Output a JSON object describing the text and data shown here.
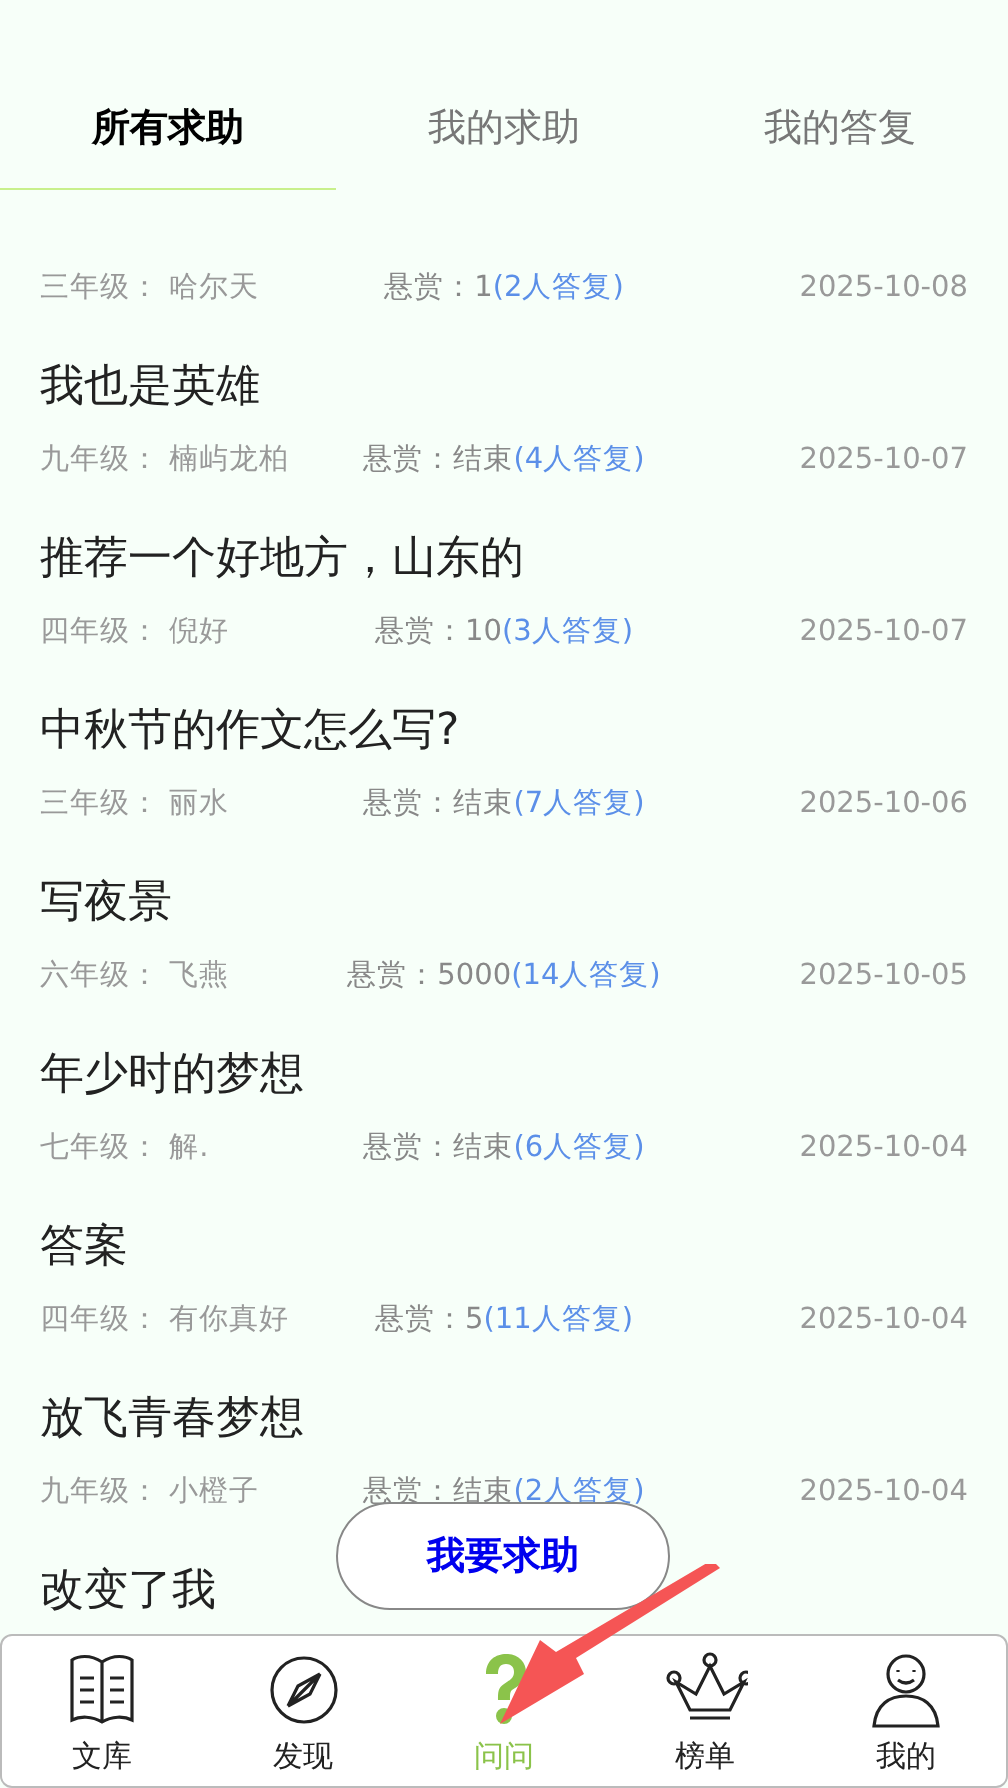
{
  "tabs": [
    {
      "label": "所有求助",
      "selected": true
    },
    {
      "label": "我的求助",
      "selected": false
    },
    {
      "label": "我的答复",
      "selected": false
    }
  ],
  "posts": [
    {
      "grade": "三年级：",
      "author": "哈尔天",
      "reward": "悬赏：1",
      "replies": "(2人答复)",
      "date": "2025-10-08"
    },
    {
      "title": "我也是英雄",
      "grade": "九年级：",
      "author": "楠屿龙柏",
      "reward": "悬赏：结束",
      "replies": "(4人答复)",
      "date": "2025-10-07"
    },
    {
      "title": "推荐一个好地方，山东的",
      "grade": "四年级：",
      "author": "倪好",
      "reward": "悬赏：10",
      "replies": "(3人答复)",
      "date": "2025-10-07"
    },
    {
      "title": "中秋节的作文怎么写?",
      "grade": "三年级：",
      "author": "丽水",
      "reward": "悬赏：结束",
      "replies": "(7人答复)",
      "date": "2025-10-06"
    },
    {
      "title": "写夜景",
      "grade": "六年级：",
      "author": "飞燕",
      "reward": "悬赏：5000",
      "replies": "(14人答复)",
      "date": "2025-10-05"
    },
    {
      "title": "年少时的梦想",
      "grade": "七年级：",
      "author": "解.",
      "reward": "悬赏：结束",
      "replies": "(6人答复)",
      "date": "2025-10-04"
    },
    {
      "title": "答案",
      "grade": "四年级：",
      "author": "有你真好",
      "reward": "悬赏：5",
      "replies": "(11人答复)",
      "date": "2025-10-04"
    },
    {
      "title": "放飞青春梦想",
      "grade": "九年级：",
      "author": "小橙子",
      "reward": "悬赏：结束",
      "replies": "(2人答复)",
      "date": "2025-10-04"
    },
    {
      "title": "改变了我"
    }
  ],
  "ask_button": "我要求助",
  "nav": [
    {
      "label": "文库",
      "selected": false
    },
    {
      "label": "发现",
      "selected": false
    },
    {
      "label": "问问",
      "selected": true
    },
    {
      "label": "榜单",
      "selected": false
    },
    {
      "label": "我的",
      "selected": false
    }
  ]
}
